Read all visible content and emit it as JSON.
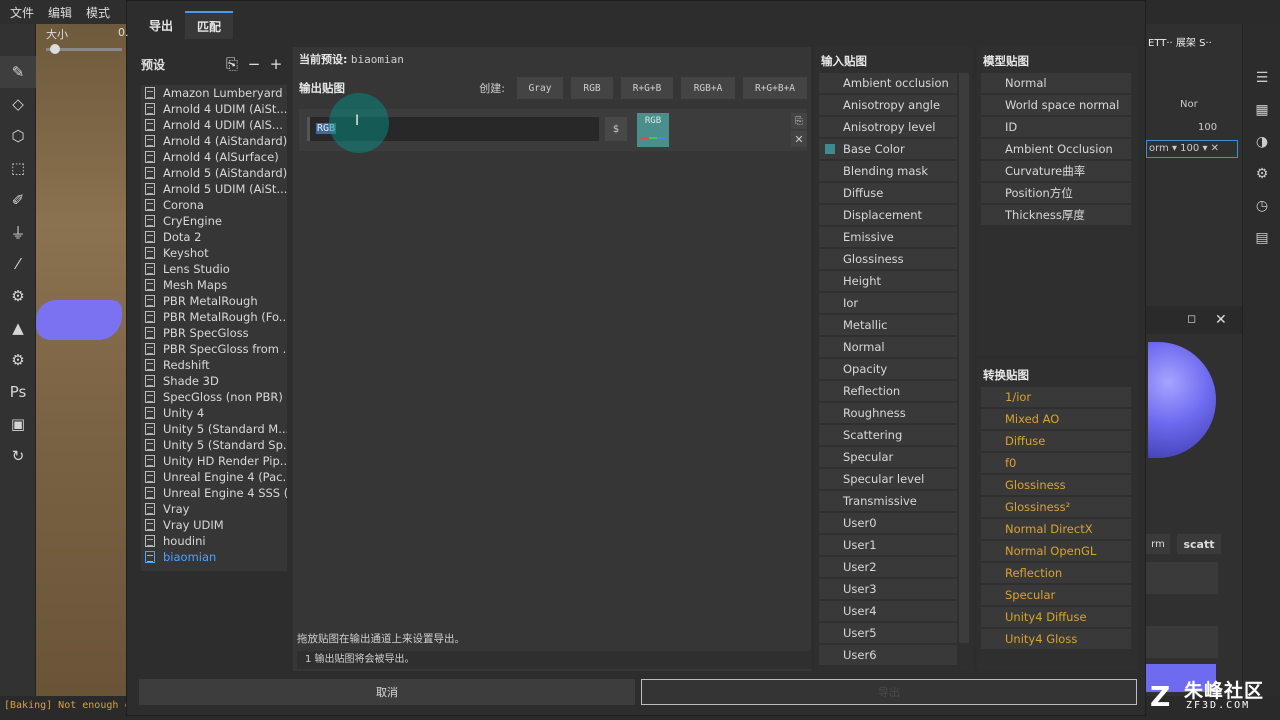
{
  "app": {
    "menu": [
      "文件",
      "编辑",
      "模式"
    ],
    "size_label": "大小",
    "size_value": "0.",
    "status_message": "[Baking] Not enough c",
    "right_panel": {
      "header": "ETT·· 展架 S··",
      "norm_label": "Nor",
      "value_a": "100",
      "selected_row": "orm ▾ 100 ▾ ✕",
      "scatt_label": "scatt",
      "rm_label": "rm"
    }
  },
  "dialog": {
    "tabs": [
      "导出",
      "匹配"
    ],
    "active_tab": 1,
    "presets": {
      "title": "预设",
      "items": [
        "Amazon Lumberyard",
        "Arnold 4  UDIM (AiSt...",
        "Arnold 4  UDIM (AlS...",
        "Arnold 4 (AiStandard)",
        "Arnold 4 (AlSurface)",
        "Arnold 5 (AiStandard)",
        "Arnold 5 UDIM (AiSt...",
        "Corona",
        "CryEngine",
        "Dota 2",
        "Keyshot",
        "Lens Studio",
        "Mesh Maps",
        "PBR MetalRough",
        "PBR MetalRough (Fo...",
        "PBR SpecGloss",
        "PBR SpecGloss from ...",
        "Redshift",
        "Shade 3D",
        "SpecGloss (non PBR)",
        "Unity 4",
        "Unity 5 (Standard M...",
        "Unity 5 (Standard Sp...",
        "Unity HD Render Pip...",
        "Unreal Engine 4 (Pac...",
        "Unreal Engine 4 SSS (...",
        "Vray",
        "Vray UDIM",
        "houdini",
        "biaomian"
      ],
      "selected_index": 29
    },
    "center": {
      "current_preset_label": "当前预设:",
      "current_preset_value": "biaomian",
      "output_maps_title": "输出贴图",
      "create_label": "创建:",
      "create_buttons": [
        "Gray",
        "RGB",
        "R+G+B",
        "RGB+A",
        "R+G+B+A"
      ],
      "channel_name": "RGB",
      "dollar": "$",
      "swatch_label": "RGB",
      "hint_drag": "拖放贴图在输出通道上来设置导出。",
      "hint_count": "1 输出贴图将会被导出。"
    },
    "input_maps": {
      "title": "输入贴图",
      "items": [
        "Ambient occlusion",
        "Anisotropy angle",
        "Anisotropy level",
        "Base Color",
        "Blending mask",
        "Diffuse",
        "Displacement",
        "Emissive",
        "Glossiness",
        "Height",
        "Ior",
        "Metallic",
        "Normal",
        "Opacity",
        "Reflection",
        "Roughness",
        "Scattering",
        "Specular",
        "Specular level",
        "Transmissive",
        "User0",
        "User1",
        "User2",
        "User3",
        "User4",
        "User5",
        "User6"
      ],
      "checked_index": 3,
      "checked_color": "#3e8a8e"
    },
    "mesh_maps": {
      "title": "模型贴图",
      "items": [
        "Normal",
        "World space normal",
        "ID",
        "Ambient Occlusion",
        "Curvature曲率",
        "Position方位",
        "Thickness厚度"
      ]
    },
    "converted_maps": {
      "title": "转换贴图",
      "items": [
        "1/ior",
        "Mixed AO",
        "Diffuse",
        "f0",
        "Glossiness",
        "Glossiness²",
        "Normal DirectX",
        "Normal OpenGL",
        "Reflection",
        "Specular",
        "Unity4 Diffuse",
        "Unity4 Gloss"
      ],
      "color": "#d9a232"
    },
    "footer": {
      "cancel": "取消",
      "export": "导出"
    }
  },
  "watermark": {
    "title": "朱峰社区",
    "subtitle": "ZF3D.COM"
  },
  "colors": {
    "accent": "#4b9bec",
    "selected_preset": "#4aa3ff",
    "cursor_highlight": "#00968c"
  }
}
